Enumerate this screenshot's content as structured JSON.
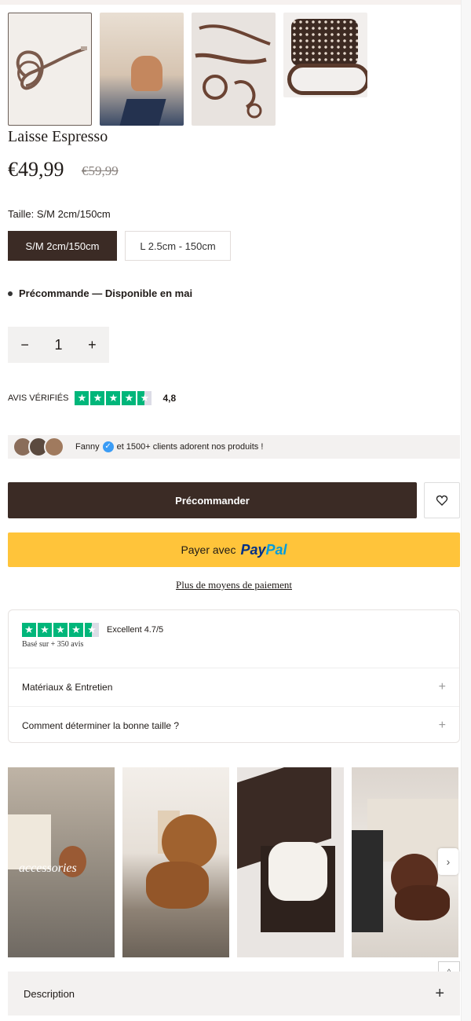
{
  "product": {
    "title": "Laisse Espresso",
    "price": "€49,99",
    "old_price": "€59,99"
  },
  "gallery_thumbs": [
    "leash-coiled",
    "leash-on-dog",
    "leash-set-flatlay",
    "leash-and-bag"
  ],
  "size": {
    "label": "Taille: S/M 2cm/150cm",
    "options": [
      "S/M 2cm/150cm",
      "L 2.5cm - 150cm"
    ],
    "selected": "S/M 2cm/150cm"
  },
  "stock": {
    "text": "Précommande — Disponible en mai"
  },
  "quantity": {
    "minus": "−",
    "value": "1",
    "plus": "+"
  },
  "reviews": {
    "label": "AVIS VÉRIFIÉS",
    "score": "4,8"
  },
  "social_proof": {
    "name": "Fanny",
    "text": "et 1500+ clients adorent nos produits !"
  },
  "cta": {
    "preorder": "Précommander",
    "paypal_prefix": "Payer avec",
    "paypal_logo_1": "Pay",
    "paypal_logo_2": "Pal",
    "more_payment": "Plus de moyens de paiement"
  },
  "trust": {
    "rating_text": "Excellent 4.7/5",
    "based_on": "Basé sur + 350 avis"
  },
  "accordions": [
    {
      "label": "Matériaux & Entretien",
      "icon": "+"
    },
    {
      "label": "Comment déterminer la bonne taille ?",
      "icon": "+"
    }
  ],
  "gallery_caption": "accessories",
  "description": {
    "label": "Description",
    "icon": "+"
  },
  "colors": {
    "brand_dark": "#3b2b25",
    "paypal_yellow": "#ffc43a",
    "trustpilot_green": "#00b67a"
  }
}
